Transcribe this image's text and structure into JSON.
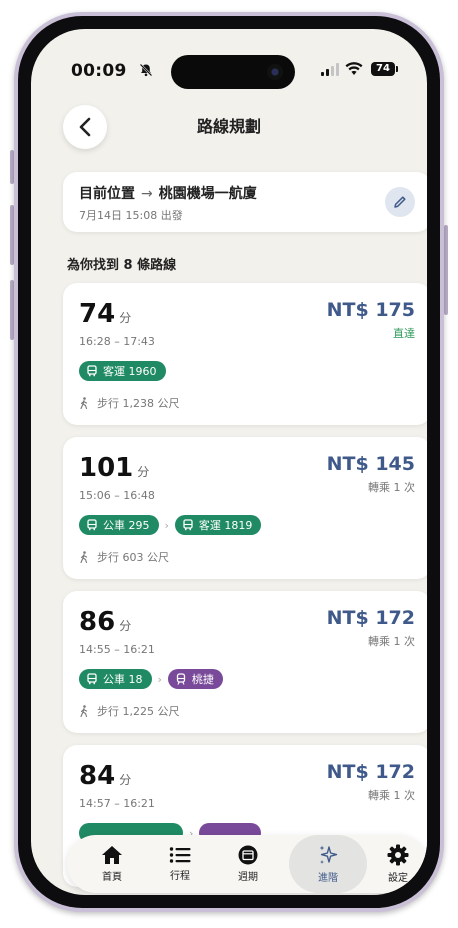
{
  "status_bar": {
    "time": "00:09",
    "battery": "74"
  },
  "header": {
    "title": "路線規劃"
  },
  "route": {
    "origin": "目前位置",
    "arrow": "→",
    "destination": "桃園機場一航廈",
    "depart_info": "7月14日 15:08 出發"
  },
  "results_summary": "為你找到 8 條路線",
  "routes": [
    {
      "duration": "74",
      "unit": "分",
      "time_range": "16:28 – 17:43",
      "price": "NT$ 175",
      "note": "直達",
      "legs": [
        {
          "type": "bus",
          "label": "客運 1960",
          "color": "#1f8a63"
        }
      ],
      "walk": "步行 1,238 公尺"
    },
    {
      "duration": "101",
      "unit": "分",
      "time_range": "15:06 – 16:48",
      "price": "NT$ 145",
      "note": "轉乘 1 次",
      "legs": [
        {
          "type": "bus",
          "label": "公車 295",
          "color": "#1f8a63"
        },
        {
          "type": "bus",
          "label": "客運 1819",
          "color": "#1f8a63"
        }
      ],
      "walk": "步行 603 公尺"
    },
    {
      "duration": "86",
      "unit": "分",
      "time_range": "14:55 – 16:21",
      "price": "NT$ 172",
      "note": "轉乘 1 次",
      "legs": [
        {
          "type": "bus",
          "label": "公車 18",
          "color": "#1f8a63"
        },
        {
          "type": "metro",
          "label": "桃捷",
          "color": "#7a4a9a"
        }
      ],
      "walk": "步行 1,225 公尺"
    },
    {
      "duration": "84",
      "unit": "分",
      "time_range": "14:57 – 16:21",
      "price": "NT$ 172",
      "note": "轉乘 1 次",
      "legs": [],
      "walk": ""
    }
  ],
  "tabs": [
    {
      "label": "首頁",
      "icon": "home-icon",
      "active": false
    },
    {
      "label": "行程",
      "icon": "list-icon",
      "active": false
    },
    {
      "label": "週期",
      "icon": "calendar-icon",
      "active": false
    },
    {
      "label": "進階",
      "icon": "sparkle-icon",
      "active": true
    },
    {
      "label": "設定",
      "icon": "gear-icon",
      "active": false
    }
  ],
  "colors": {
    "accent": "#3f5a8a",
    "bus": "#1f8a63",
    "metro": "#7a4a9a",
    "direct": "#2d9a5a"
  }
}
